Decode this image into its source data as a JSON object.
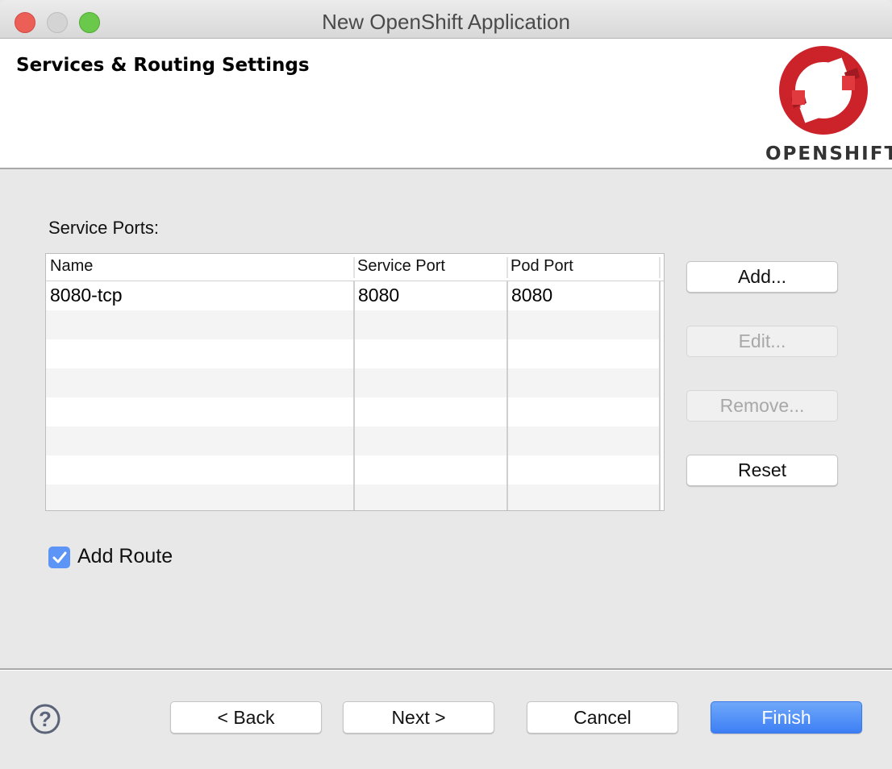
{
  "window": {
    "title": "New OpenShift Application"
  },
  "banner": {
    "title": "Services & Routing Settings",
    "logo_text": "OPENSHIFT",
    "logo_icon": "openshift-logo-icon",
    "logo_color": "#cc2229"
  },
  "service_ports": {
    "label": "Service Ports:",
    "columns": [
      "Name",
      "Service Port",
      "Pod Port"
    ],
    "rows": [
      [
        "8080-tcp",
        "8080",
        "8080"
      ],
      [
        "",
        "",
        ""
      ],
      [
        "",
        "",
        ""
      ],
      [
        "",
        "",
        ""
      ],
      [
        "",
        "",
        ""
      ],
      [
        "",
        "",
        ""
      ],
      [
        "",
        "",
        ""
      ],
      [
        "",
        "",
        ""
      ]
    ]
  },
  "side_buttons": {
    "add": "Add...",
    "edit": "Edit...",
    "remove": "Remove...",
    "reset": "Reset"
  },
  "add_route": {
    "label": "Add Route",
    "checked": true,
    "accent": "#5c95f5"
  },
  "footer": {
    "help_icon": "help-icon",
    "back": "< Back",
    "next": "Next >",
    "cancel": "Cancel",
    "finish": "Finish"
  }
}
